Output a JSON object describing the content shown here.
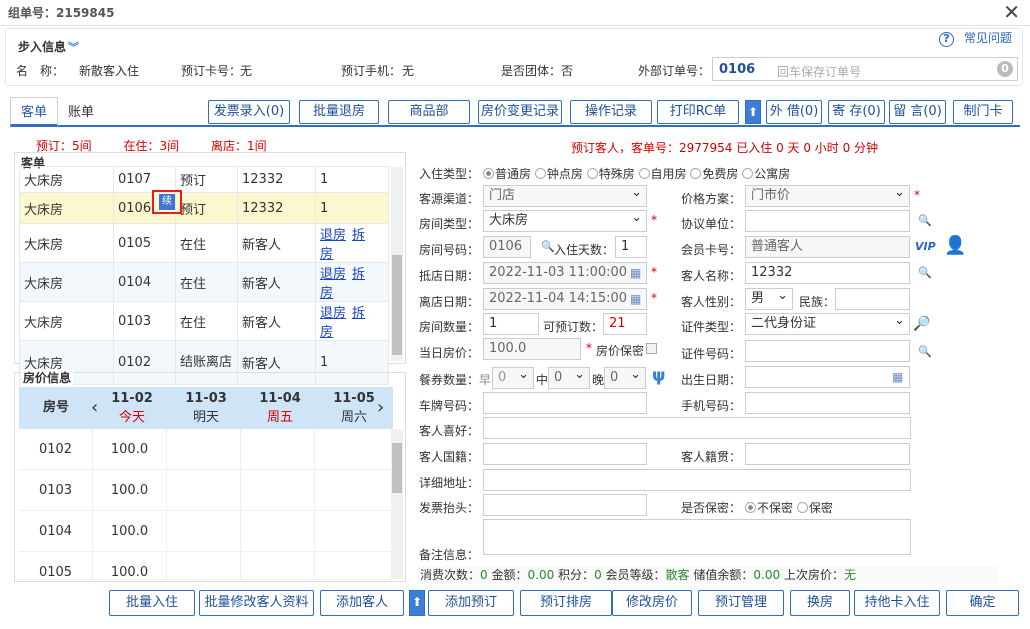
{
  "title": "组单号：2159845",
  "faq": "常见问题",
  "walkin": {
    "header": "步入信息",
    "name_label": "名　称：",
    "name_value": "新散客入住",
    "card_label": "预订卡号：",
    "card_value": "无",
    "phone_label": "预订手机：",
    "phone_value": "无",
    "group_label": "是否团体：",
    "group_value": "否",
    "ext_label": "外部订单号：",
    "ext_value": "0106",
    "ext_placeholder": "回车保存订单号"
  },
  "tabs": [
    "客单",
    "账单"
  ],
  "toolbar": [
    "发票录入(0)",
    "批量退房",
    "商品部",
    "房价变更记录",
    "操作记录",
    "打印RC单",
    "外 借(0)",
    "寄 存(0)",
    "留 言(0)",
    "制门卡"
  ],
  "counts": {
    "reserved": "预订：5间",
    "in_house": "在住：3间",
    "departed": "离店：1间"
  },
  "reservation_msg": "预订客人，客单号：2977954 已入住 0 天 0 小时 0 分钟",
  "room_list": {
    "header": "客单",
    "xu_badge": "续",
    "rows": [
      {
        "type": "大床房",
        "room": "0107",
        "status": "预订",
        "guest": "12332",
        "last": "1"
      },
      {
        "type": "大床房",
        "room": "0106",
        "status": "预订",
        "guest": "12332",
        "last": "1"
      },
      {
        "type": "大床房",
        "room": "0105",
        "status": "在住",
        "guest": "新客人",
        "a": "退房",
        "b": "拆房"
      },
      {
        "type": "大床房",
        "room": "0104",
        "status": "在住",
        "guest": "新客人",
        "a": "退房",
        "b": "拆房"
      },
      {
        "type": "大床房",
        "room": "0103",
        "status": "在住",
        "guest": "新客人",
        "a": "退房",
        "b": "拆房"
      },
      {
        "type": "大床房",
        "room": "0102",
        "status": "结账离店",
        "guest": "新客人",
        "last": "1"
      }
    ]
  },
  "prices": {
    "header": "房价信息",
    "room_col": "房号",
    "dates": [
      {
        "d": "11-02",
        "w": "今天",
        "red": true
      },
      {
        "d": "11-03",
        "w": "明天",
        "red": false
      },
      {
        "d": "11-04",
        "w": "周五",
        "red": true
      },
      {
        "d": "11-05",
        "w": "周六",
        "red": false
      }
    ],
    "rows": [
      {
        "room": "0102",
        "p": "100.0"
      },
      {
        "room": "0103",
        "p": "100.0"
      },
      {
        "room": "0104",
        "p": "100.0"
      },
      {
        "room": "0105",
        "p": "100.0"
      }
    ]
  },
  "form": {
    "checkin_type_label": "入住类型：",
    "checkin_types": [
      "普通房",
      "钟点房",
      "特殊房",
      "自用房",
      "免费房",
      "公寓房"
    ],
    "source_label": "客源渠道：",
    "source_value": "门店",
    "price_plan_label": "价格方案：",
    "price_plan_value": "门市价",
    "room_type_label": "房间类型：",
    "room_type_value": "大床房",
    "agreement_label": "协议单位：",
    "room_no_label": "房间号码：",
    "room_no_value": "0106",
    "days_label": "入住天数：",
    "days_value": "1",
    "member_label": "会员卡号：",
    "member_value": "普通客人",
    "vip": "VIP",
    "arrive_label": "抵店日期：",
    "arrive_value": "2022-11-03 11:00:00",
    "guest_name_label": "客人名称：",
    "guest_name_value": "12332",
    "depart_label": "离店日期：",
    "depart_value": "2022-11-04 14:15:00",
    "gender_label": "客人性别：",
    "gender_value": "男",
    "ethnic_label": "民族：",
    "qty_label": "房间数量：",
    "qty_value": "1",
    "avail_label": "可预订数：",
    "avail_value": "21",
    "id_type_label": "证件类型：",
    "id_type_value": "二代身份证",
    "day_price_label": "当日房价：",
    "day_price_value": "100.0",
    "price_secret_label": "房价保密",
    "id_no_label": "证件号码：",
    "meal_label": "餐券数量：",
    "meals": [
      "早",
      "中",
      "晚"
    ],
    "meal_value": "0",
    "birth_label": "出生日期：",
    "plate_label": "车牌号码：",
    "mobile_label": "手机号码：",
    "hobby_label": "客人喜好：",
    "nation_label": "客人国籍：",
    "native_label": "客人籍贯：",
    "address_label": "详细地址：",
    "invoice_label": "发票抬头：",
    "secret_label": "是否保密：",
    "secret_opts": [
      "不保密",
      "保密"
    ],
    "remark_label": "备注信息："
  },
  "status_bar": {
    "t1": "消费次数：",
    "v1": "0",
    "t2": "金额：",
    "v2": "0.00",
    "t3": "积分：",
    "v3": "0",
    "t4": "会员等级：",
    "v4": "散客",
    "t5": "储值余额：",
    "v5": "0.00",
    "t6": "上次房价：",
    "v6": "无"
  },
  "bottom_buttons": [
    "批量入住",
    "批量修改客人资料",
    "添加客人",
    "添加预订",
    "预订排房",
    "修改房价",
    "预订管理",
    "换房",
    "持他卡入住",
    "确定"
  ]
}
